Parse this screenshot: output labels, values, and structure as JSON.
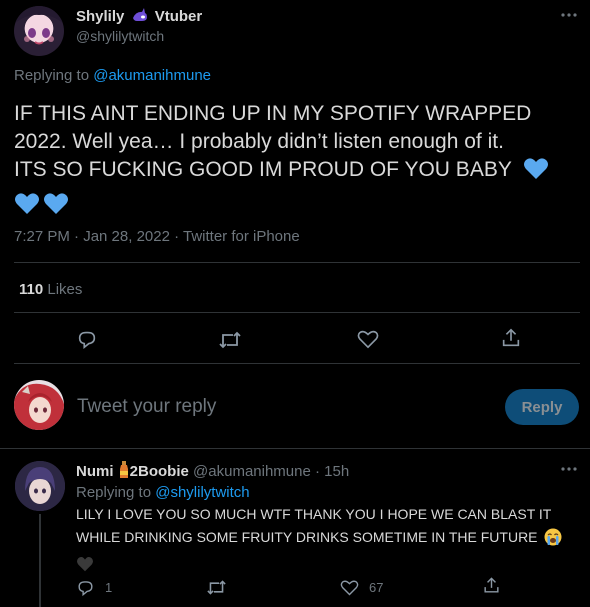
{
  "tweet": {
    "author_name": "Shylily",
    "author_tag": "Vtuber",
    "handle": "@shylilytwitch",
    "more_icon": "more-horizontal-icon",
    "replying_to_label": "Replying to",
    "replying_to_handle": "@akumanihmune",
    "text_line1": "IF THIS AINT ENDING UP IN MY SPOTIFY WRAPPED",
    "text_line2": "2022. Well yea… I probably didn’t listen enough of it.",
    "text_line3": "ITS SO FUCKING GOOD IM PROUD OF YOU BABY",
    "timestamp": "7:27 PM · Jan 28, 2022 · Twitter for iPhone",
    "likes_count": "110",
    "likes_label": "Likes",
    "heart_emoji_color": "#5aa9f0"
  },
  "actions": {
    "reply_icon": "reply-icon",
    "retweet_icon": "retweet-icon",
    "like_icon": "like-icon",
    "share_icon": "share-icon"
  },
  "compose": {
    "placeholder": "Tweet your reply",
    "reply_button_label": "Reply"
  },
  "reply": {
    "author_name": "Numi",
    "author_suffix": "2Boobie",
    "handle": "@akumanihmune",
    "time": "15h",
    "replying_to_label": "Replying to",
    "replying_to_handle": "@shylilytwitch",
    "text_line1": "LILY I LOVE YOU SO MUCH WTF THANK YOU I HOPE WE CAN BLAST IT",
    "text_line2": "WHILE DRINKING SOME FRUITY DRINKS SOMETIME IN THE FUTURE",
    "reply_count": "1",
    "like_count": "67"
  },
  "colors": {
    "background": "#000000",
    "accent": "#1d9bf0",
    "muted": "#6e767d",
    "divider": "#2f3336",
    "reply_button": "#1d9bf0"
  }
}
